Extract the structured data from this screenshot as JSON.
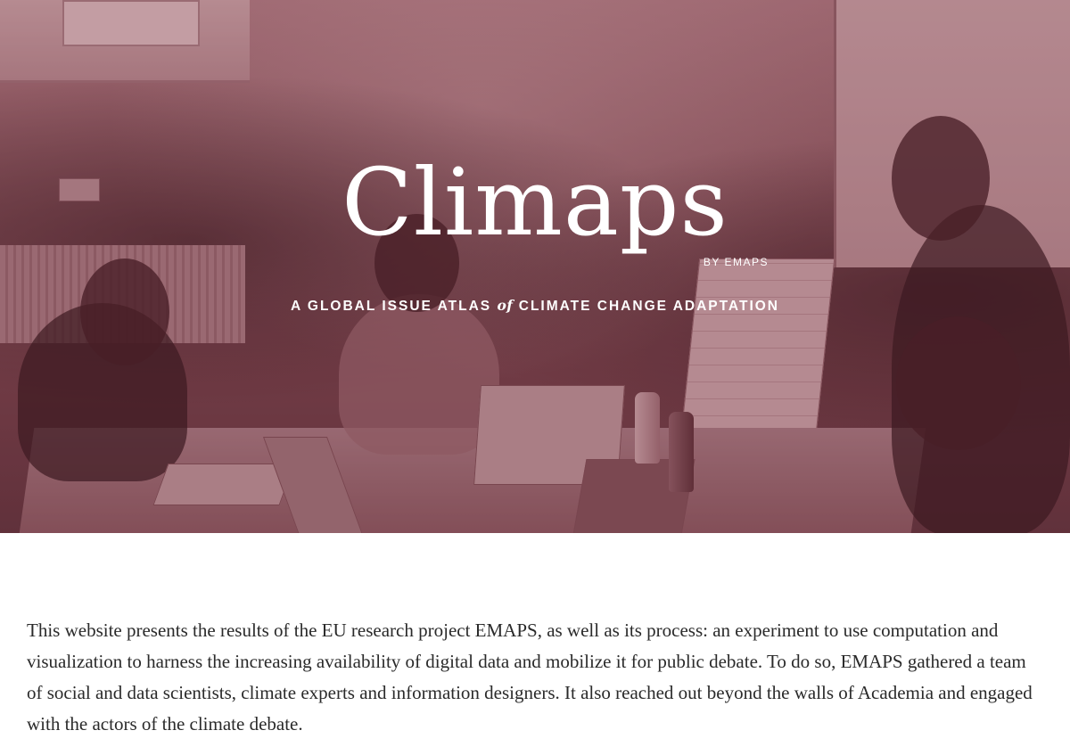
{
  "hero": {
    "title": "Climaps",
    "byline": "BY EMAPS",
    "tagline_before": "A GLOBAL ISSUE ATLAS ",
    "tagline_of": "of",
    "tagline_after": " CLIMATE CHANGE ADAPTATION"
  },
  "intro": {
    "text": "This website presents the results of the EU research project EMAPS, as well as its process: an experiment to use computation and visualization to harness the increasing availability of digital data and mobilize it for public debate. To do so, EMAPS gathered a team of social and data scientists, climate experts and information designers. It also reached out beyond the walls of Academia and engaged with the actors of the climate debate."
  },
  "colors": {
    "hero_tint": "#8c5a62",
    "text": "#2a2a2a",
    "title": "#ffffff"
  }
}
